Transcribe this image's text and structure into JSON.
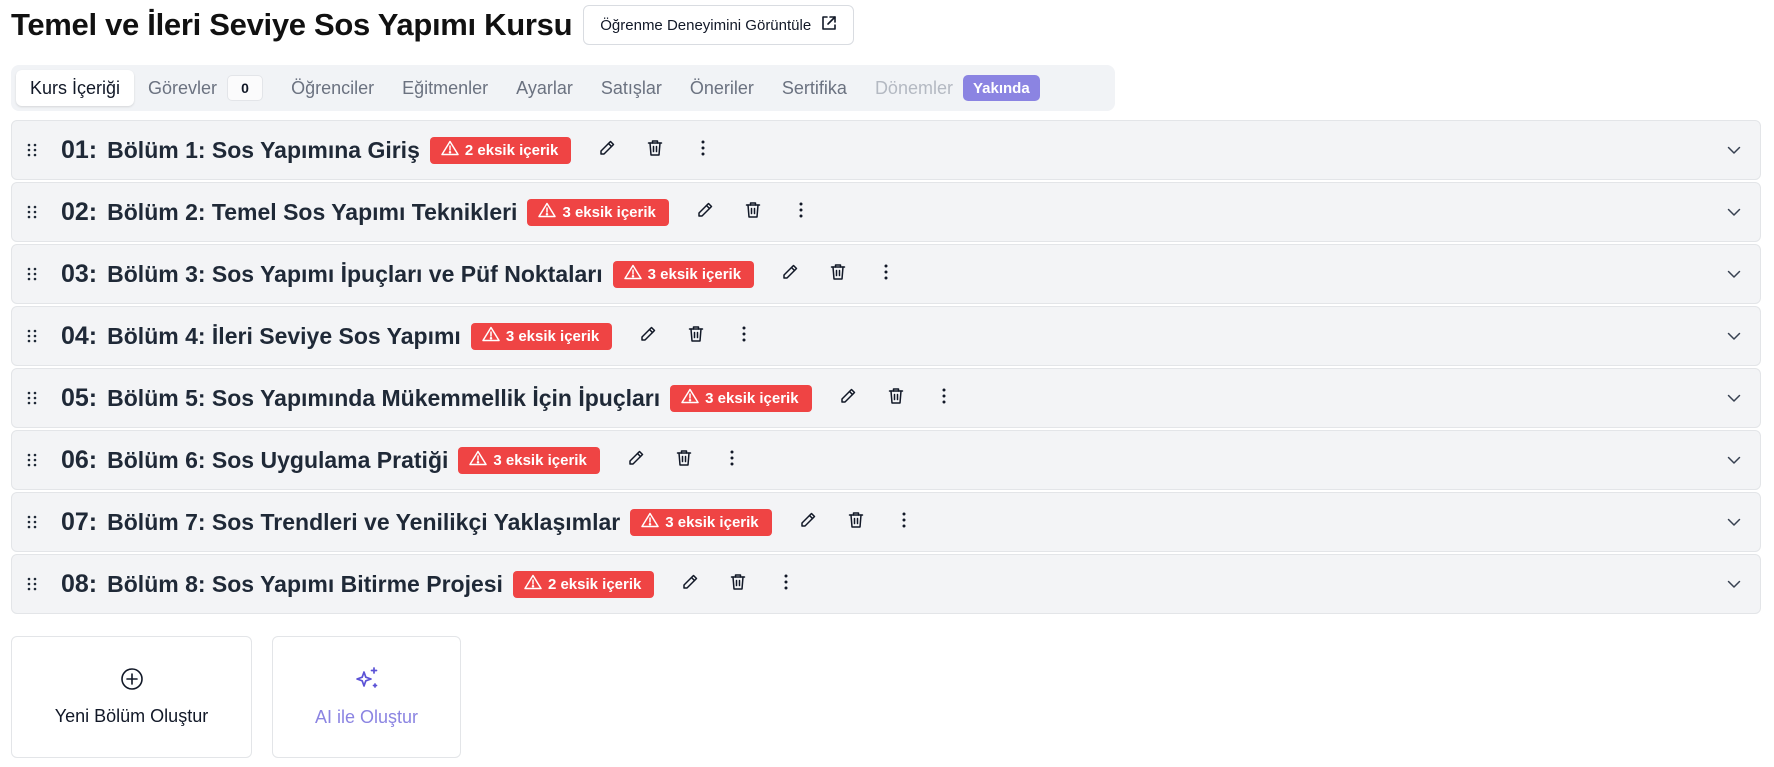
{
  "header": {
    "title": "Temel ve İleri Seviye Sos Yapımı Kursu",
    "view_button": "Öğrenme Deneyimini Görüntüle",
    "view_icon": "external-link-icon"
  },
  "tabs": [
    {
      "label": "Kurs İçeriği",
      "state": "active"
    },
    {
      "label": "Görevler",
      "badge": "0"
    },
    {
      "label": "Öğrenciler"
    },
    {
      "label": "Eğitmenler"
    },
    {
      "label": "Ayarlar"
    },
    {
      "label": "Satışlar"
    },
    {
      "label": "Öneriler"
    },
    {
      "label": "Sertifika"
    },
    {
      "label": "Dönemler",
      "state": "disabled",
      "badge": "Yakında"
    }
  ],
  "sections": [
    {
      "num": "01:",
      "title": "Bölüm 1: Sos Yapımına Giriş",
      "warning": "2 eksik içerik"
    },
    {
      "num": "02:",
      "title": "Bölüm 2: Temel Sos Yapımı Teknikleri",
      "warning": "3 eksik içerik"
    },
    {
      "num": "03:",
      "title": "Bölüm 3: Sos Yapımı İpuçları ve Püf Noktaları",
      "warning": "3 eksik içerik"
    },
    {
      "num": "04:",
      "title": "Bölüm 4: İleri Seviye Sos Yapımı",
      "warning": "3 eksik içerik"
    },
    {
      "num": "05:",
      "title": "Bölüm 5: Sos Yapımında Mükemmellik İçin İpuçları",
      "warning": "3 eksik içerik"
    },
    {
      "num": "06:",
      "title": "Bölüm 6: Sos Uygulama Pratiği",
      "warning": "3 eksik içerik"
    },
    {
      "num": "07:",
      "title": "Bölüm 7: Sos Trendleri ve Yenilikçi Yaklaşımlar",
      "warning": "3 eksik içerik"
    },
    {
      "num": "08:",
      "title": "Bölüm 8: Sos Yapımı Bitirme Projesi",
      "warning": "2 eksik içerik"
    }
  ],
  "cards": {
    "new_section": "Yeni Bölüm Oluştur",
    "ai_create": "AI ile Oluştur"
  },
  "colors": {
    "warning": "#ef4444",
    "accent": "#8b84e2",
    "row_bg": "#f3f4f6"
  }
}
